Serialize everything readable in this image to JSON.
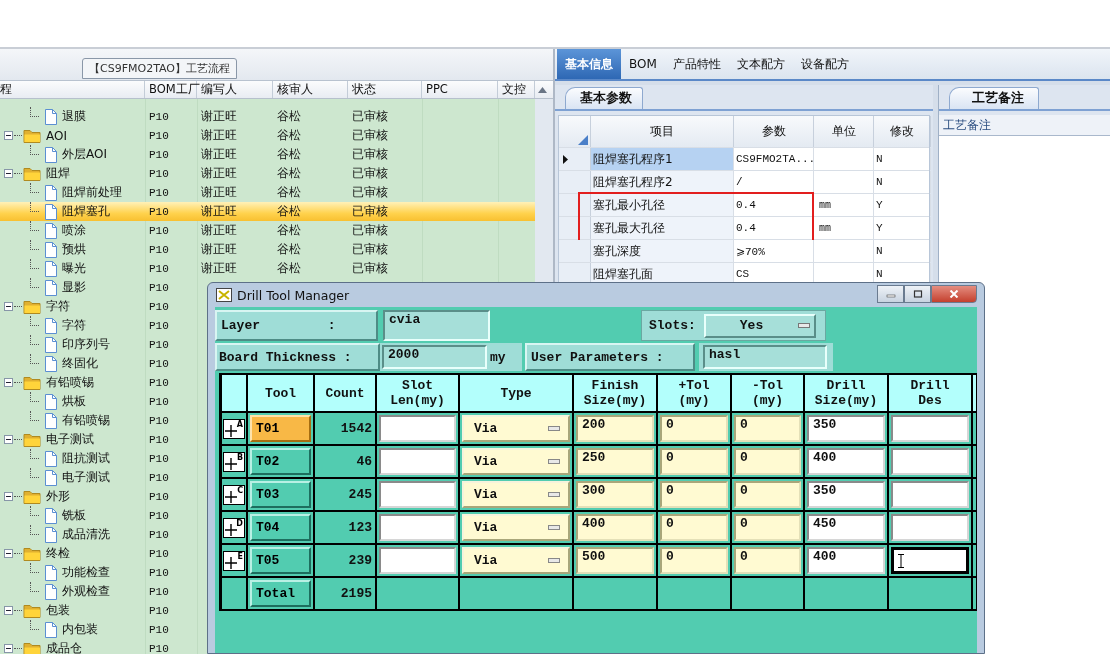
{
  "left_panel": {
    "title": "【CS9FMO2TAO】工艺流程",
    "columns": [
      "程",
      "BOM工厂",
      "编写人",
      "核审人",
      "状态",
      "PPC",
      "文控"
    ],
    "tree": [
      {
        "children": [
          {
            "name": "退膜",
            "kind": "doc",
            "bom": "P10",
            "writer": "谢正旺",
            "reviewer": "谷松",
            "status": "已审核",
            "selected": false
          }
        ]
      },
      {
        "name": "AOI",
        "kind": "folder",
        "expanded": true,
        "bom": "P10",
        "writer": "谢正旺",
        "reviewer": "谷松",
        "status": "已审核",
        "selected": false,
        "children": [
          {
            "name": "外层AOI",
            "kind": "doc",
            "bom": "P10",
            "writer": "谢正旺",
            "reviewer": "谷松",
            "status": "已审核",
            "selected": false
          }
        ]
      },
      {
        "name": "阻焊",
        "kind": "folder",
        "expanded": true,
        "bom": "P10",
        "writer": "谢正旺",
        "reviewer": "谷松",
        "status": "已审核",
        "selected": false,
        "children": [
          {
            "name": "阻焊前处理",
            "kind": "doc",
            "bom": "P10",
            "writer": "谢正旺",
            "reviewer": "谷松",
            "status": "已审核",
            "selected": false
          },
          {
            "name": "阻焊塞孔",
            "kind": "doc",
            "bom": "P10",
            "writer": "谢正旺",
            "reviewer": "谷松",
            "status": "已审核",
            "selected": true
          },
          {
            "name": "喷涂",
            "kind": "doc",
            "bom": "P10",
            "writer": "谢正旺",
            "reviewer": "谷松",
            "status": "已审核",
            "selected": false
          },
          {
            "name": "预烘",
            "kind": "doc",
            "bom": "P10",
            "writer": "谢正旺",
            "reviewer": "谷松",
            "status": "已审核",
            "selected": false
          },
          {
            "name": "曝光",
            "kind": "doc",
            "bom": "P10",
            "writer": "谢正旺",
            "reviewer": "谷松",
            "status": "已审核",
            "selected": false
          },
          {
            "name": "显影",
            "kind": "doc",
            "bom": "P10",
            "selected": false
          }
        ]
      },
      {
        "name": "字符",
        "kind": "folder",
        "expanded": true,
        "bom": "P10",
        "selected": false,
        "children": [
          {
            "name": "字符",
            "kind": "doc",
            "bom": "P10",
            "selected": false
          },
          {
            "name": "印序列号",
            "kind": "doc",
            "bom": "P10",
            "selected": false
          },
          {
            "name": "终固化",
            "kind": "doc",
            "bom": "P10",
            "selected": false
          }
        ]
      },
      {
        "name": "有铅喷锡",
        "kind": "folder",
        "expanded": true,
        "bom": "P10",
        "selected": false,
        "children": [
          {
            "name": "烘板",
            "kind": "doc",
            "bom": "P10",
            "selected": false
          },
          {
            "name": "有铅喷锡",
            "kind": "doc",
            "bom": "P10",
            "selected": false
          }
        ]
      },
      {
        "name": "电子测试",
        "kind": "folder",
        "expanded": true,
        "bom": "P10",
        "selected": false,
        "children": [
          {
            "name": "阻抗测试",
            "kind": "doc",
            "bom": "P10",
            "selected": false
          },
          {
            "name": "电子测试",
            "kind": "doc",
            "bom": "P10",
            "selected": false
          }
        ]
      },
      {
        "name": "外形",
        "kind": "folder",
        "expanded": true,
        "bom": "P10",
        "selected": false,
        "children": [
          {
            "name": "铣板",
            "kind": "doc",
            "bom": "P10",
            "selected": false
          },
          {
            "name": "成品清洗",
            "kind": "doc",
            "bom": "P10",
            "selected": false
          }
        ]
      },
      {
        "name": "终检",
        "kind": "folder",
        "expanded": true,
        "bom": "P10",
        "selected": false,
        "children": [
          {
            "name": "功能检查",
            "kind": "doc",
            "bom": "P10",
            "selected": false
          },
          {
            "name": "外观检查",
            "kind": "doc",
            "bom": "P10",
            "selected": false
          }
        ]
      },
      {
        "name": "包装",
        "kind": "folder",
        "expanded": true,
        "bom": "P10",
        "selected": false,
        "children": [
          {
            "name": "内包装",
            "kind": "doc",
            "bom": "P10",
            "selected": false
          }
        ]
      },
      {
        "name": "成品仓",
        "kind": "folder",
        "expanded": true,
        "bom": "P10",
        "selected": false
      }
    ]
  },
  "right_panel": {
    "tabs": [
      {
        "label": "基本信息",
        "selected": true
      },
      {
        "label": "BOM",
        "selected": false
      },
      {
        "label": "产品特性",
        "selected": false
      },
      {
        "label": "文本配方",
        "selected": false
      },
      {
        "label": "设备配方",
        "selected": false
      }
    ],
    "params": {
      "tab": "基本参数",
      "columns": [
        "项目",
        "参数",
        "单位",
        "修改"
      ],
      "rows": [
        {
          "item": "阻焊塞孔程序1",
          "value": "CS9FMO2TA...",
          "modified": "N",
          "selected": true,
          "highlighted": false
        },
        {
          "item": "阻焊塞孔程序2",
          "value": "/",
          "modified": "N",
          "selected": false,
          "highlighted": false
        },
        {
          "item": "塞孔最小孔径",
          "value": "0.4",
          "unit": "mm",
          "modified": "Y",
          "selected": false,
          "highlighted": true
        },
        {
          "item": "塞孔最大孔径",
          "value": "0.4",
          "unit": "mm",
          "modified": "Y",
          "selected": false,
          "highlighted": true
        },
        {
          "item": "塞孔深度",
          "value": "⩾70%",
          "modified": "N",
          "selected": false,
          "highlighted": false
        },
        {
          "item": "阻焊塞孔面",
          "value": "CS",
          "modified": "N",
          "selected": false,
          "highlighted": false
        }
      ]
    },
    "notes": {
      "tab": "工艺备注",
      "label": "工艺备注"
    }
  },
  "drill_window": {
    "title": "Drill Tool Manager",
    "layer_label": "Layer :",
    "layer": "cvia",
    "slots_label": "Slots:",
    "slots": "Yes",
    "thickness_label": "Board Thickness :",
    "thickness": "2000",
    "thickness_unit": "my",
    "user_params_label": "User Parameters :",
    "user_params": "hasl",
    "columns": [
      "Tool",
      "Count",
      "Slot\nLen(my)",
      "Type",
      "Finish\nSize(my)",
      "+Tol\n(my)",
      "-Tol\n(my)",
      "Drill\nSize(my)",
      "Drill\nDes"
    ],
    "tools": [
      {
        "tag": "A",
        "tool": "T01",
        "count": "1542",
        "type": "Via",
        "finish": "200",
        "plus_tol": "0",
        "minus_tol": "0",
        "drill_size": "350",
        "selected": true,
        "des_focused": false
      },
      {
        "tag": "B",
        "tool": "T02",
        "count": "46",
        "type": "Via",
        "finish": "250",
        "plus_tol": "0",
        "minus_tol": "0",
        "drill_size": "400",
        "selected": false,
        "des_focused": false
      },
      {
        "tag": "C",
        "tool": "T03",
        "count": "245",
        "type": "Via",
        "finish": "300",
        "plus_tol": "0",
        "minus_tol": "0",
        "drill_size": "350",
        "selected": false,
        "des_focused": false
      },
      {
        "tag": "D",
        "tool": "T04",
        "count": "123",
        "type": "Via",
        "finish": "400",
        "plus_tol": "0",
        "minus_tol": "0",
        "drill_size": "450",
        "selected": false,
        "des_focused": false
      },
      {
        "tag": "E",
        "tool": "T05",
        "count": "239",
        "type": "Via",
        "finish": "500",
        "plus_tol": "0",
        "minus_tol": "0",
        "drill_size": "400",
        "selected": false,
        "des_focused": true
      }
    ],
    "total": {
      "label": "Total",
      "count": "2195"
    }
  }
}
